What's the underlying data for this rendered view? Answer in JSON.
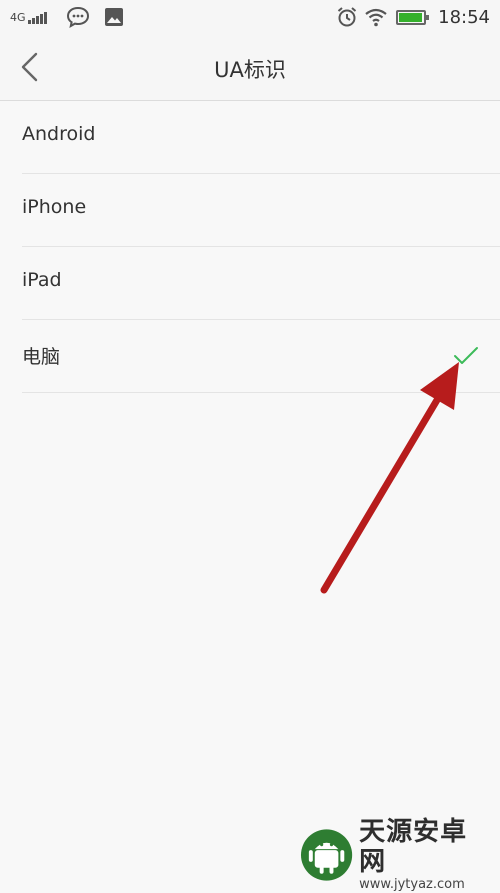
{
  "status_bar": {
    "network": "4G",
    "time": "18:54",
    "battery_level": 0.95,
    "battery_color": "#35b02c"
  },
  "header": {
    "title": "UA标识",
    "back_icon": "chevron-left-icon"
  },
  "options": [
    {
      "label": "Android",
      "selected": false
    },
    {
      "label": "iPhone",
      "selected": false
    },
    {
      "label": "iPad",
      "selected": false
    },
    {
      "label": "电脑",
      "selected": true
    }
  ],
  "colors": {
    "check": "#3dbb5a",
    "annotation_arrow": "#b71c1c"
  },
  "watermark": {
    "title": "天源安卓网",
    "url": "www.jytyaz.com"
  }
}
